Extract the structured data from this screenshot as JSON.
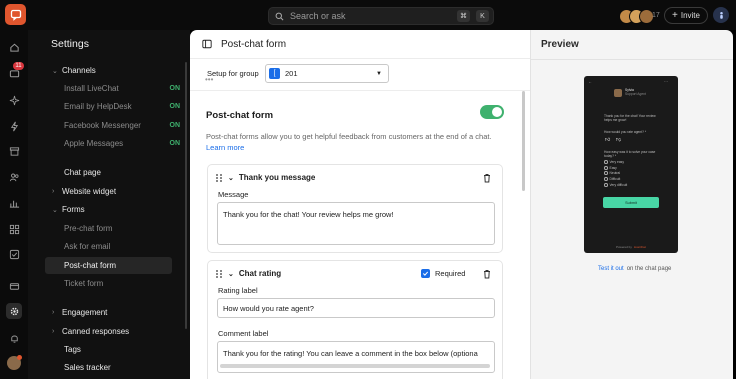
{
  "topbar": {
    "search_placeholder": "Search or ask",
    "kbd_cmd": "⌘",
    "kbd_k": "K",
    "online_count": "17",
    "invite_label": "Invite"
  },
  "rail": {
    "notification_badge": "11"
  },
  "sidebar": {
    "title": "Settings",
    "items": [
      {
        "label": "Channels",
        "chevron": "⌄"
      },
      {
        "label": "Install LiveChat",
        "status": "ON"
      },
      {
        "label": "Email by HelpDesk",
        "status": "ON"
      },
      {
        "label": "Facebook Messenger",
        "status": "ON"
      },
      {
        "label": "Apple Messages",
        "status": "ON"
      },
      {
        "label": "Chat page"
      },
      {
        "label": "Website widget",
        "chevron": "›"
      },
      {
        "label": "Forms",
        "chevron": "⌄"
      },
      {
        "label": "Pre-chat form"
      },
      {
        "label": "Ask for email"
      },
      {
        "label": "Post-chat form"
      },
      {
        "label": "Ticket form"
      },
      {
        "label": "Engagement",
        "chevron": "›"
      },
      {
        "label": "Canned responses",
        "chevron": "›"
      },
      {
        "label": "Tags"
      },
      {
        "label": "Sales tracker"
      }
    ]
  },
  "main": {
    "title": "Post-chat form",
    "group_label": "Setup for group",
    "group_value": "201",
    "group_icon_letter": "[",
    "section_title": "Post-chat form",
    "description": "Post-chat forms allow you to get helpful feedback from customers at the end of a chat.",
    "learn_more": "Learn more",
    "thank_you": {
      "title": "Thank you message",
      "message_label": "Message",
      "message_value": "Thank you for the chat! Your review helps me grow!"
    },
    "rating": {
      "title": "Chat rating",
      "required_label": "Required",
      "rating_label": "Rating label",
      "rating_value": "How would you rate agent?",
      "comment_label": "Comment label",
      "comment_value": "Thank you for the rating! You can leave a comment in the box below (optiona"
    }
  },
  "preview": {
    "title": "Preview",
    "test_link": "Test it out",
    "test_suffix": "on the chat page",
    "phone": {
      "agent_name": "Sylvia",
      "agent_role": "Support Agent",
      "msg": "Thank you for the chat! Your review helps me grow!",
      "q1": "How would you rate agent? *",
      "q2": "How easy was it to solve your case today? *",
      "options": [
        "Very easy",
        "Easy",
        "Neutral",
        "Difficult",
        "Very difficult"
      ],
      "submit": "Submit",
      "powered": "Powered by",
      "brand": "LiveChat"
    }
  },
  "colors": {
    "accent": "#1a6de8",
    "toggle_on": "#3fb16e",
    "brand": "#e0562e",
    "submit": "#48d6a5"
  }
}
